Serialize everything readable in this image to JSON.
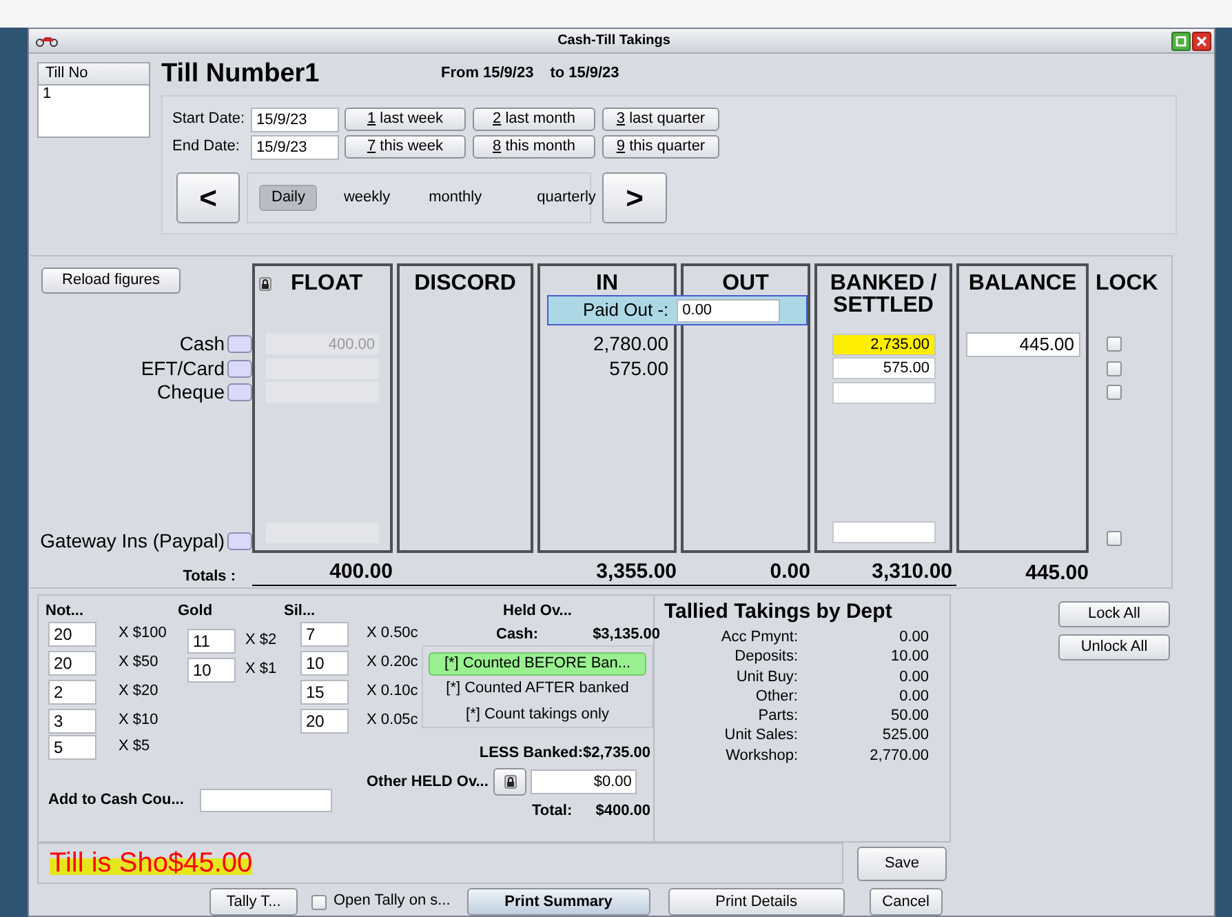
{
  "window": {
    "title": "Cash-Till Takings"
  },
  "till_list": {
    "header": "Till No",
    "items": [
      {
        "label": "1",
        "selected": false
      }
    ]
  },
  "heading": "Till Number1",
  "range": {
    "from_label": "From",
    "from": "15/9/23",
    "to_label": "to",
    "to": "15/9/23"
  },
  "dates": [
    {
      "label": "Start Date:",
      "value": "15/9/23"
    },
    {
      "label": "End Date:",
      "value": "15/9/23"
    }
  ],
  "quick_buttons": [
    {
      "key": "1",
      "label": " last week"
    },
    {
      "key": "2",
      "label": " last month"
    },
    {
      "key": "3",
      "label": " last quarter"
    },
    {
      "key": "7",
      "label": " this week"
    },
    {
      "key": "8",
      "label": " this month"
    },
    {
      "key": "9",
      "label": " this quarter"
    }
  ],
  "nav": {
    "prev": "<",
    "next": ">",
    "periods": [
      {
        "label": "Daily",
        "selected": true
      },
      {
        "label": "weekly",
        "selected": false
      },
      {
        "label": "monthly",
        "selected": false
      },
      {
        "label": "quarterly",
        "selected": false
      }
    ]
  },
  "reload_button": "Reload figures",
  "columns": [
    "FLOAT",
    "DISCORD",
    "IN",
    "OUT",
    "BANKED / SETTLED",
    "BALANCE",
    "LOCK"
  ],
  "paid_out": {
    "label": "Paid Out -:",
    "value": "0.00"
  },
  "rows": [
    {
      "label": "Cash",
      "float": "400.00",
      "in": "2,780.00",
      "banked": "2,735.00",
      "banked_highlighted": true,
      "balance": "445.00",
      "locked": false
    },
    {
      "label": "EFT/Card",
      "in": "575.00",
      "banked": "575.00",
      "banked_highlighted": false,
      "locked": false
    },
    {
      "label": "Cheque",
      "banked_highlighted": false,
      "locked": false
    },
    {
      "label": "Gateway Ins (Paypal)",
      "banked_highlighted": false,
      "locked": false
    }
  ],
  "totals": {
    "label": "Totals :",
    "float": "400.00",
    "in": "3,355.00",
    "out": "0.00",
    "banked": "3,310.00",
    "balance": "445.00"
  },
  "notes": {
    "header": "Not...",
    "items": [
      {
        "count": "20",
        "label": "X $100"
      },
      {
        "count": "20",
        "label": "X $50"
      },
      {
        "count": "2",
        "label": "X $20"
      },
      {
        "count": "3",
        "label": "X $10"
      },
      {
        "count": "5",
        "label": "X $5"
      }
    ]
  },
  "gold": {
    "header": "Gold",
    "items": [
      {
        "count": "11",
        "label": "X $2"
      },
      {
        "count": "10",
        "label": "X $1"
      }
    ]
  },
  "silver": {
    "header": "Sil...",
    "items": [
      {
        "count": "7",
        "label": "X 0.50c"
      },
      {
        "count": "10",
        "label": "X 0.20c"
      },
      {
        "count": "15",
        "label": "X 0.10c"
      },
      {
        "count": "20",
        "label": "X 0.05c"
      }
    ]
  },
  "add_to_cash": {
    "label": "Add to Cash Cou..."
  },
  "held_over": {
    "title": "Held Ov...",
    "cash_label": "Cash:",
    "cash": "$3,135.00",
    "options": [
      {
        "label": "[*] Counted BEFORE Ban...",
        "selected": true
      },
      {
        "label": "[*] Counted AFTER banked",
        "selected": false
      },
      {
        "label": "[*] Count takings only",
        "selected": false
      }
    ],
    "less_banked": "LESS Banked:$2,735.00",
    "other_label": "Other HELD Ov...",
    "other_value": "$0.00",
    "total_label": "Total:",
    "total": "$400.00"
  },
  "dept": {
    "title": "Tallied Takings by Dept",
    "items": [
      {
        "label": "Acc Pmynt:",
        "value": "0.00"
      },
      {
        "label": "Deposits:",
        "value": "10.00"
      },
      {
        "label": "Unit Buy:",
        "value": "0.00"
      },
      {
        "label": "Other:",
        "value": "0.00"
      },
      {
        "label": "Parts:",
        "value": "50.00"
      },
      {
        "label": "Unit Sales:",
        "value": "525.00"
      },
      {
        "label": "Workshop:",
        "value": "2,770.00"
      }
    ]
  },
  "lock_buttons": [
    "Lock All",
    "Unlock All"
  ],
  "status": {
    "text": "Till is Sho",
    "amount": "$45.00"
  },
  "save": "Save",
  "footer": {
    "tally": "Tally T...",
    "open_tally": {
      "label": "Open Tally on s...",
      "checked": false
    },
    "print_summary": "Print Summary",
    "print_details": "Print Details",
    "cancel": "Cancel"
  }
}
